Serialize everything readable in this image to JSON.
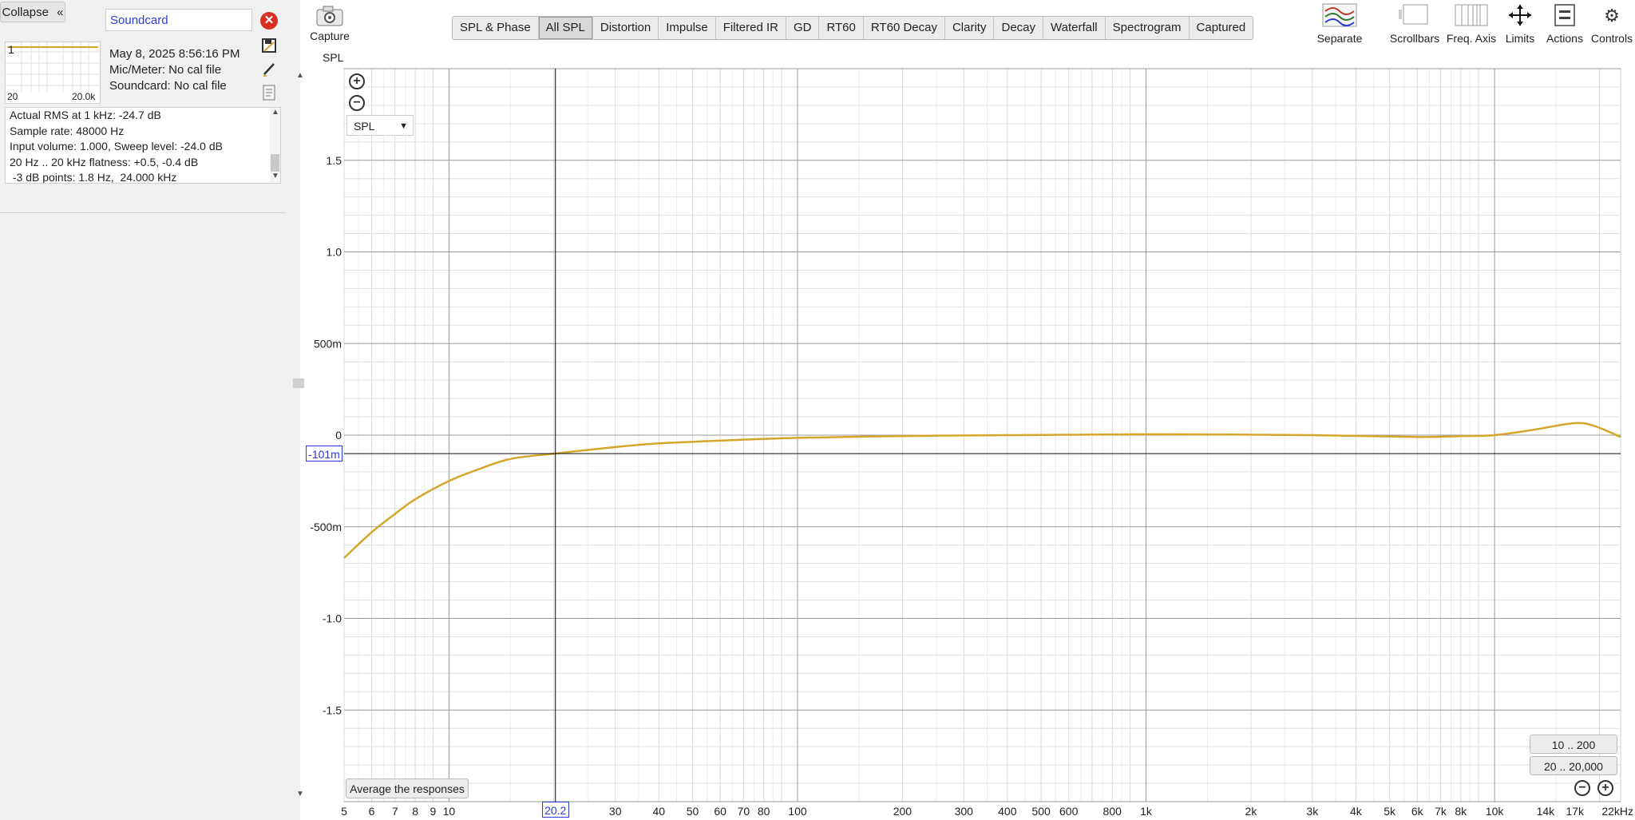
{
  "left_panel": {
    "collapse_label": "Collapse",
    "collapse_glyph": "«",
    "measurement_name": "Soundcard",
    "measurement_index": "1",
    "mini_graph": {
      "x_min": "20",
      "x_max": "20.0k"
    },
    "info": {
      "date": "May 8, 2025 8:56:16 PM",
      "mic": "Mic/Meter: No cal file",
      "soundcard": "Soundcard: No cal file"
    },
    "notes": [
      "Actual RMS at 1 kHz: -24.7 dB",
      "Sample rate: 48000 Hz",
      "Input volume: 1.000, Sweep level: -24.0 dB",
      "20 Hz .. 20 kHz flatness: +0.5, -0.4 dB",
      " -3 dB points: 1.8 Hz,  24.000 kHz"
    ],
    "icons": [
      "remove-icon",
      "save-icon",
      "edit-icon",
      "notes-icon"
    ]
  },
  "toolbar": {
    "capture_label": "Capture",
    "tabs": [
      {
        "label": "SPL & Phase",
        "active": false
      },
      {
        "label": "All SPL",
        "active": true
      },
      {
        "label": "Distortion",
        "active": false
      },
      {
        "label": "Impulse",
        "active": false
      },
      {
        "label": "Filtered IR",
        "active": false
      },
      {
        "label": "GD",
        "active": false
      },
      {
        "label": "RT60",
        "active": false
      },
      {
        "label": "RT60 Decay",
        "active": false
      },
      {
        "label": "Clarity",
        "active": false
      },
      {
        "label": "Decay",
        "active": false
      },
      {
        "label": "Waterfall",
        "active": false
      },
      {
        "label": "Spectrogram",
        "active": false
      },
      {
        "label": "Captured",
        "active": false
      }
    ],
    "tools": {
      "separate": "Separate",
      "scrollbars": "Scrollbars",
      "freq_axis": "Freq. Axis",
      "limits": "Limits",
      "actions": "Actions",
      "controls": "Controls"
    }
  },
  "plot": {
    "ylabel": "SPL",
    "select_value": "SPL",
    "average_button": "Average the responses",
    "range_buttons": [
      "10 .. 200",
      "20 .. 20,000"
    ],
    "cursor_y_value": "-101m",
    "cursor_x_value": "20.2",
    "curve_color": "#d4a72c"
  },
  "chart_data": {
    "type": "line",
    "ylabel": "SPL",
    "x_scale": "log",
    "xlim": [
      5,
      23000
    ],
    "ylim": [
      -2.0,
      2.0
    ],
    "grid": true,
    "y_ticks": [
      1.5,
      1.0,
      0.5,
      0,
      -0.5,
      -1.0,
      -1.5
    ],
    "y_tick_labels": [
      "1.5",
      "1.0",
      "500m",
      "0",
      "-500m",
      "-1.0",
      "-1.5"
    ],
    "x_tick_labels": [
      {
        "v": 5,
        "t": "5"
      },
      {
        "v": 6,
        "t": "6"
      },
      {
        "v": 7,
        "t": "7"
      },
      {
        "v": 8,
        "t": "8"
      },
      {
        "v": 9,
        "t": "9"
      },
      {
        "v": 10,
        "t": "10"
      },
      {
        "v": 30,
        "t": "30"
      },
      {
        "v": 40,
        "t": "40"
      },
      {
        "v": 50,
        "t": "50"
      },
      {
        "v": 60,
        "t": "60"
      },
      {
        "v": 70,
        "t": "70"
      },
      {
        "v": 80,
        "t": "80"
      },
      {
        "v": 100,
        "t": "100"
      },
      {
        "v": 200,
        "t": "200"
      },
      {
        "v": 300,
        "t": "300"
      },
      {
        "v": 400,
        "t": "400"
      },
      {
        "v": 500,
        "t": "500"
      },
      {
        "v": 600,
        "t": "600"
      },
      {
        "v": 800,
        "t": "800"
      },
      {
        "v": 1000,
        "t": "1k"
      },
      {
        "v": 2000,
        "t": "2k"
      },
      {
        "v": 3000,
        "t": "3k"
      },
      {
        "v": 4000,
        "t": "4k"
      },
      {
        "v": 5000,
        "t": "5k"
      },
      {
        "v": 6000,
        "t": "6k"
      },
      {
        "v": 7000,
        "t": "7k"
      },
      {
        "v": 8000,
        "t": "8k"
      },
      {
        "v": 10000,
        "t": "10k"
      },
      {
        "v": 14000,
        "t": "14k"
      },
      {
        "v": 17000,
        "t": "17k"
      },
      {
        "v": 22000,
        "t": "22kHz"
      }
    ],
    "cursor": {
      "x": 20.2,
      "y": -0.101
    },
    "series": [
      {
        "x": [
          5,
          6,
          7,
          8,
          10,
          12,
          15,
          20.2,
          30,
          40,
          60,
          100,
          200,
          400,
          1000,
          3000,
          6000,
          8000,
          10000,
          13000,
          16000,
          18000,
          20000,
          23000
        ],
        "y": [
          -0.67,
          -0.53,
          -0.43,
          -0.35,
          -0.25,
          -0.19,
          -0.13,
          -0.1,
          -0.065,
          -0.045,
          -0.03,
          -0.015,
          -0.005,
          0.0,
          0.005,
          0.0,
          -0.01,
          -0.005,
          0.0,
          0.03,
          0.06,
          0.065,
          0.04,
          -0.01
        ]
      }
    ]
  }
}
